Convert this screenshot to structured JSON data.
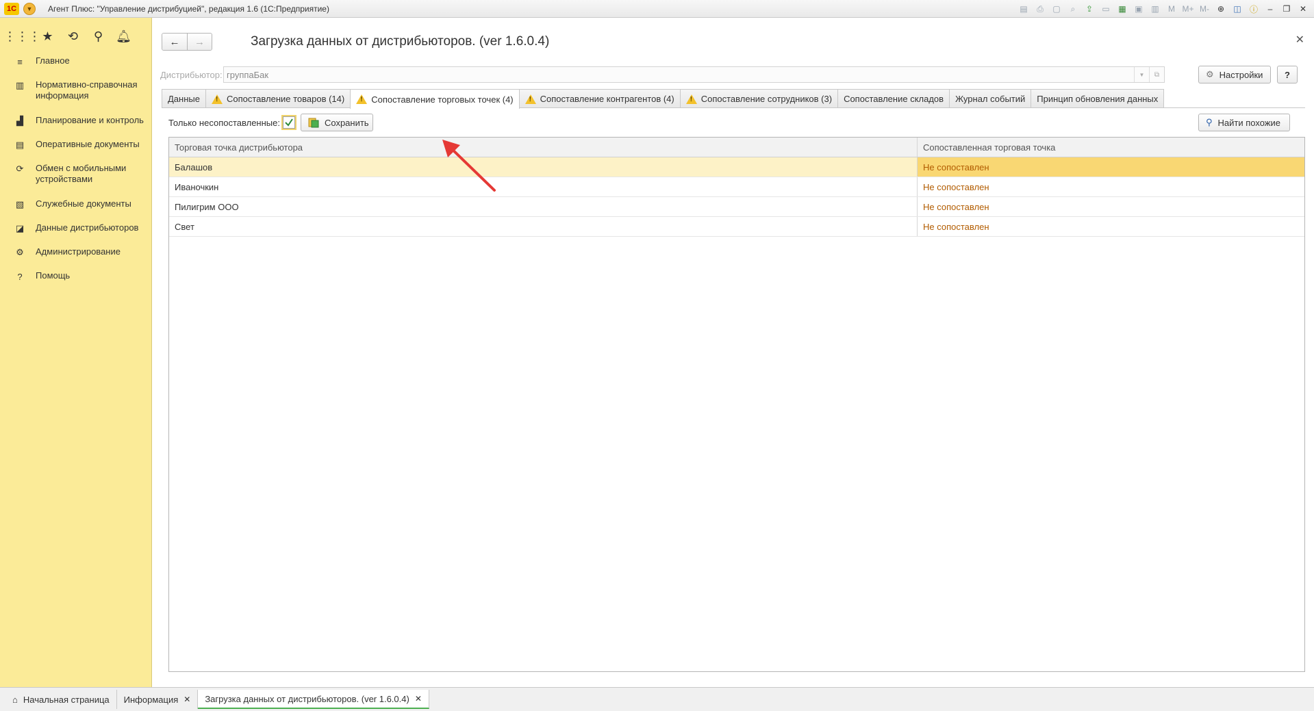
{
  "window": {
    "title": "Агент Плюс: \"Управление дистрибуцией\", редакция 1.6 (1С:Предприятие)",
    "logo": "1С"
  },
  "sidebar": {
    "top_icons": [
      "apps-grid-icon",
      "star-icon",
      "history-icon",
      "search-icon",
      "bell-icon"
    ],
    "items": [
      {
        "label": "Главное",
        "icon": "menu-lines-icon"
      },
      {
        "label": "Нормативно-справочная информация",
        "icon": "catalog-icon"
      },
      {
        "label": "Планирование и контроль",
        "icon": "chart-icon"
      },
      {
        "label": "Оперативные документы",
        "icon": "documents-icon"
      },
      {
        "label": "Обмен с мобильными устройствами",
        "icon": "sync-icon"
      },
      {
        "label": "Служебные документы",
        "icon": "service-docs-icon"
      },
      {
        "label": "Данные дистрибьюторов",
        "icon": "distributor-data-icon"
      },
      {
        "label": "Администрирование",
        "icon": "gear-icon"
      },
      {
        "label": "Помощь",
        "icon": "question-icon"
      }
    ]
  },
  "form": {
    "title": "Загрузка данных от дистрибьюторов. (ver 1.6.0.4)",
    "distributor_label": "Дистрибьютор:",
    "distributor_value": "группаБак",
    "settings_label": "Настройки",
    "help_label": "?"
  },
  "tabs": [
    {
      "label": "Данные",
      "warn": false,
      "active": false
    },
    {
      "label": "Сопоставление товаров (14)",
      "warn": true,
      "active": false
    },
    {
      "label": "Сопоставление торговых точек (4)",
      "warn": true,
      "active": true
    },
    {
      "label": "Сопоставление контрагентов (4)",
      "warn": true,
      "active": false
    },
    {
      "label": "Сопоставление сотрудников (3)",
      "warn": true,
      "active": false
    },
    {
      "label": "Сопоставление складов",
      "warn": false,
      "active": false
    },
    {
      "label": "Журнал событий",
      "warn": false,
      "active": false
    },
    {
      "label": "Принцип обновления данных",
      "warn": false,
      "active": false
    }
  ],
  "toolbar": {
    "only_unmatched_label": "Только несопоставленные:",
    "only_unmatched_checked": true,
    "save_label": "Сохранить",
    "find_similar_label": "Найти похожие"
  },
  "table": {
    "columns": [
      "Торговая точка дистрибьютора",
      "Сопоставленная торговая точка"
    ],
    "rows": [
      [
        "Балашов",
        "Не сопоставлен"
      ],
      [
        "Иваночкин",
        "Не сопоставлен"
      ],
      [
        "Пилигрим ООО",
        "Не сопоставлен"
      ],
      [
        "Свет",
        "Не сопоставлен"
      ]
    ],
    "selected_row": 0
  },
  "taskbar": {
    "items": [
      {
        "label": "Начальная страница",
        "icon": "home-icon",
        "closable": false,
        "active": false
      },
      {
        "label": "Информация",
        "closable": true,
        "active": false
      },
      {
        "label": "Загрузка данных от дистрибьюторов. (ver 1.6.0.4)",
        "closable": true,
        "active": true
      }
    ]
  },
  "colors": {
    "sidebar_bg": "#fbeb98",
    "selected_row": "#fdf2c7",
    "selected_cell": "#f9d773",
    "unmatched_text": "#b25c00",
    "annotation_arrow": "#e53935",
    "active_task_underline": "#4caf50"
  }
}
